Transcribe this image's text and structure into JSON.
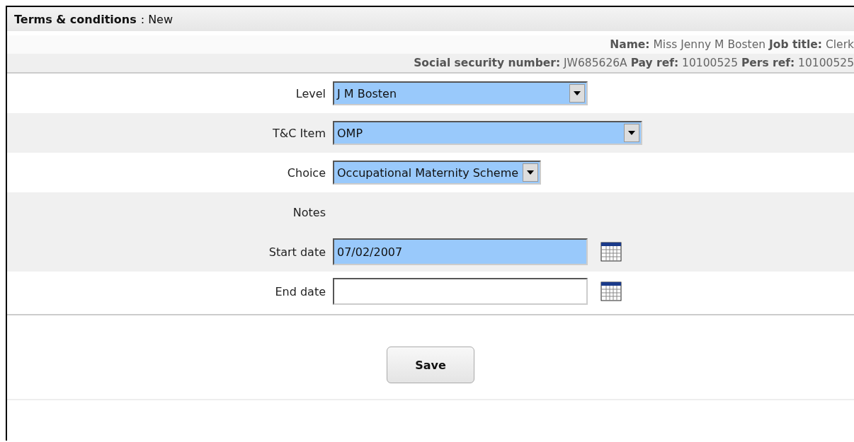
{
  "header": {
    "title": "Terms & conditions",
    "status": ": New"
  },
  "info_lines": [
    "**Name:** Miss Jenny M Bosten **Job title:** Clerk",
    "**Social security number:** JW685626A **Pay ref:** 10100525 **Pers ref:** 10100525"
  ],
  "fields": [
    {
      "kind": "select",
      "label": "Level",
      "value": "J M Bosten",
      "highlighted": true
    },
    {
      "kind": "select",
      "label": "T&C Item",
      "value": "OMP",
      "highlighted": true
    },
    {
      "kind": "select",
      "label": "Choice",
      "value": "Occupational Maternity Scheme",
      "highlighted": true
    },
    {
      "kind": "label",
      "label": "Notes"
    },
    {
      "kind": "date",
      "label": "Start date",
      "value": "07/02/2007",
      "highlighted": true
    },
    {
      "kind": "date",
      "label": "End date",
      "highlighted": false
    }
  ],
  "buttons": [
    "Save"
  ]
}
